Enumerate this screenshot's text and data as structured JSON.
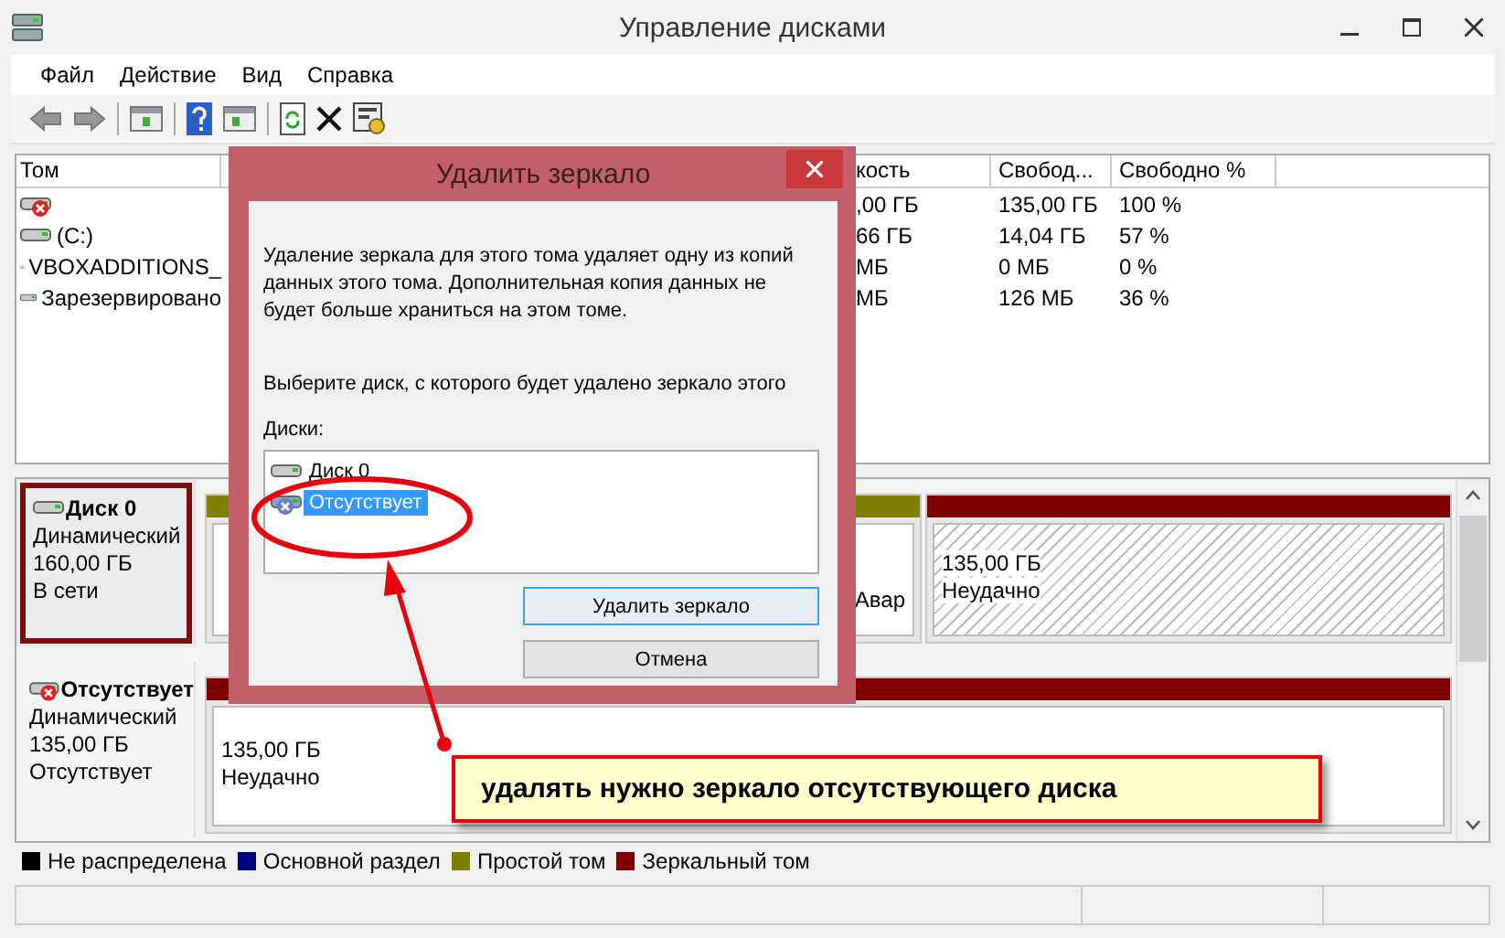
{
  "window": {
    "title": "Управление дисками"
  },
  "menu": [
    "Файл",
    "Действие",
    "Вид",
    "Справка"
  ],
  "volumes": {
    "columns": [
      "Том",
      "кость",
      "Свобод...",
      "Свободно %"
    ],
    "rows": [
      {
        "kind": "failed",
        "capacity": ",00 ГБ",
        "free": "135,00 ГБ",
        "free_pct": "100 %"
      },
      {
        "kind": "disk",
        "name": "(C:)",
        "capacity": "66 ГБ",
        "free": "14,04 ГБ",
        "free_pct": "57 %"
      },
      {
        "kind": "cd",
        "name": "VBOXADDITIONS_",
        "capacity": "МБ",
        "free": "0 МБ",
        "free_pct": "0 %"
      },
      {
        "kind": "disk",
        "name": "Зарезервировано",
        "capacity": "МБ",
        "free": "126 МБ",
        "free_pct": "36 %"
      }
    ]
  },
  "disks": [
    {
      "kind": "online",
      "name": "Диск 0",
      "type": "Динамический",
      "size": "160,00 ГБ",
      "status": "В сети",
      "highlighted": true,
      "partitions": [
        {
          "color": "#808000",
          "hatched": false,
          "tail": "Авар"
        },
        {
          "color": "#800000",
          "hatched": true,
          "lines": [
            "135,00 ГБ",
            "Неудачно"
          ]
        }
      ]
    },
    {
      "kind": "missing",
      "name": "Отсутствует",
      "type": "Динамический",
      "size": "135,00 ГБ",
      "status": "Отсутствует",
      "highlighted": false,
      "partitions": [
        {
          "color": "#800000",
          "hatched": false,
          "lines": [
            "135,00 ГБ",
            "Неудачно"
          ]
        }
      ]
    }
  ],
  "legend": [
    {
      "label": "Не распределена",
      "color": "#000000"
    },
    {
      "label": "Основной раздел",
      "color": "#000080"
    },
    {
      "label": "Простой том",
      "color": "#808000"
    },
    {
      "label": "Зеркальный том",
      "color": "#800000"
    }
  ],
  "dialog": {
    "title": "Удалить зеркало",
    "message": "Удаление зеркала для этого тома удаляет одну из копий данных этого тома. Дополнительная копия данных не будет больше храниться на этом томе.",
    "prompt": "Выберите диск, с которого будет удалено зеркало этого",
    "list_label": "Диски:",
    "disks": [
      {
        "kind": "disk",
        "label": "Диск 0",
        "selected": false
      },
      {
        "kind": "missing",
        "label": "Отсутствует",
        "selected": true
      }
    ],
    "buttons": [
      {
        "label": "Удалить зеркало",
        "default": true
      },
      {
        "label": "Отмена",
        "default": false
      }
    ]
  },
  "annotation": {
    "callout": "удалять нужно зеркало отсутствующего диска"
  }
}
